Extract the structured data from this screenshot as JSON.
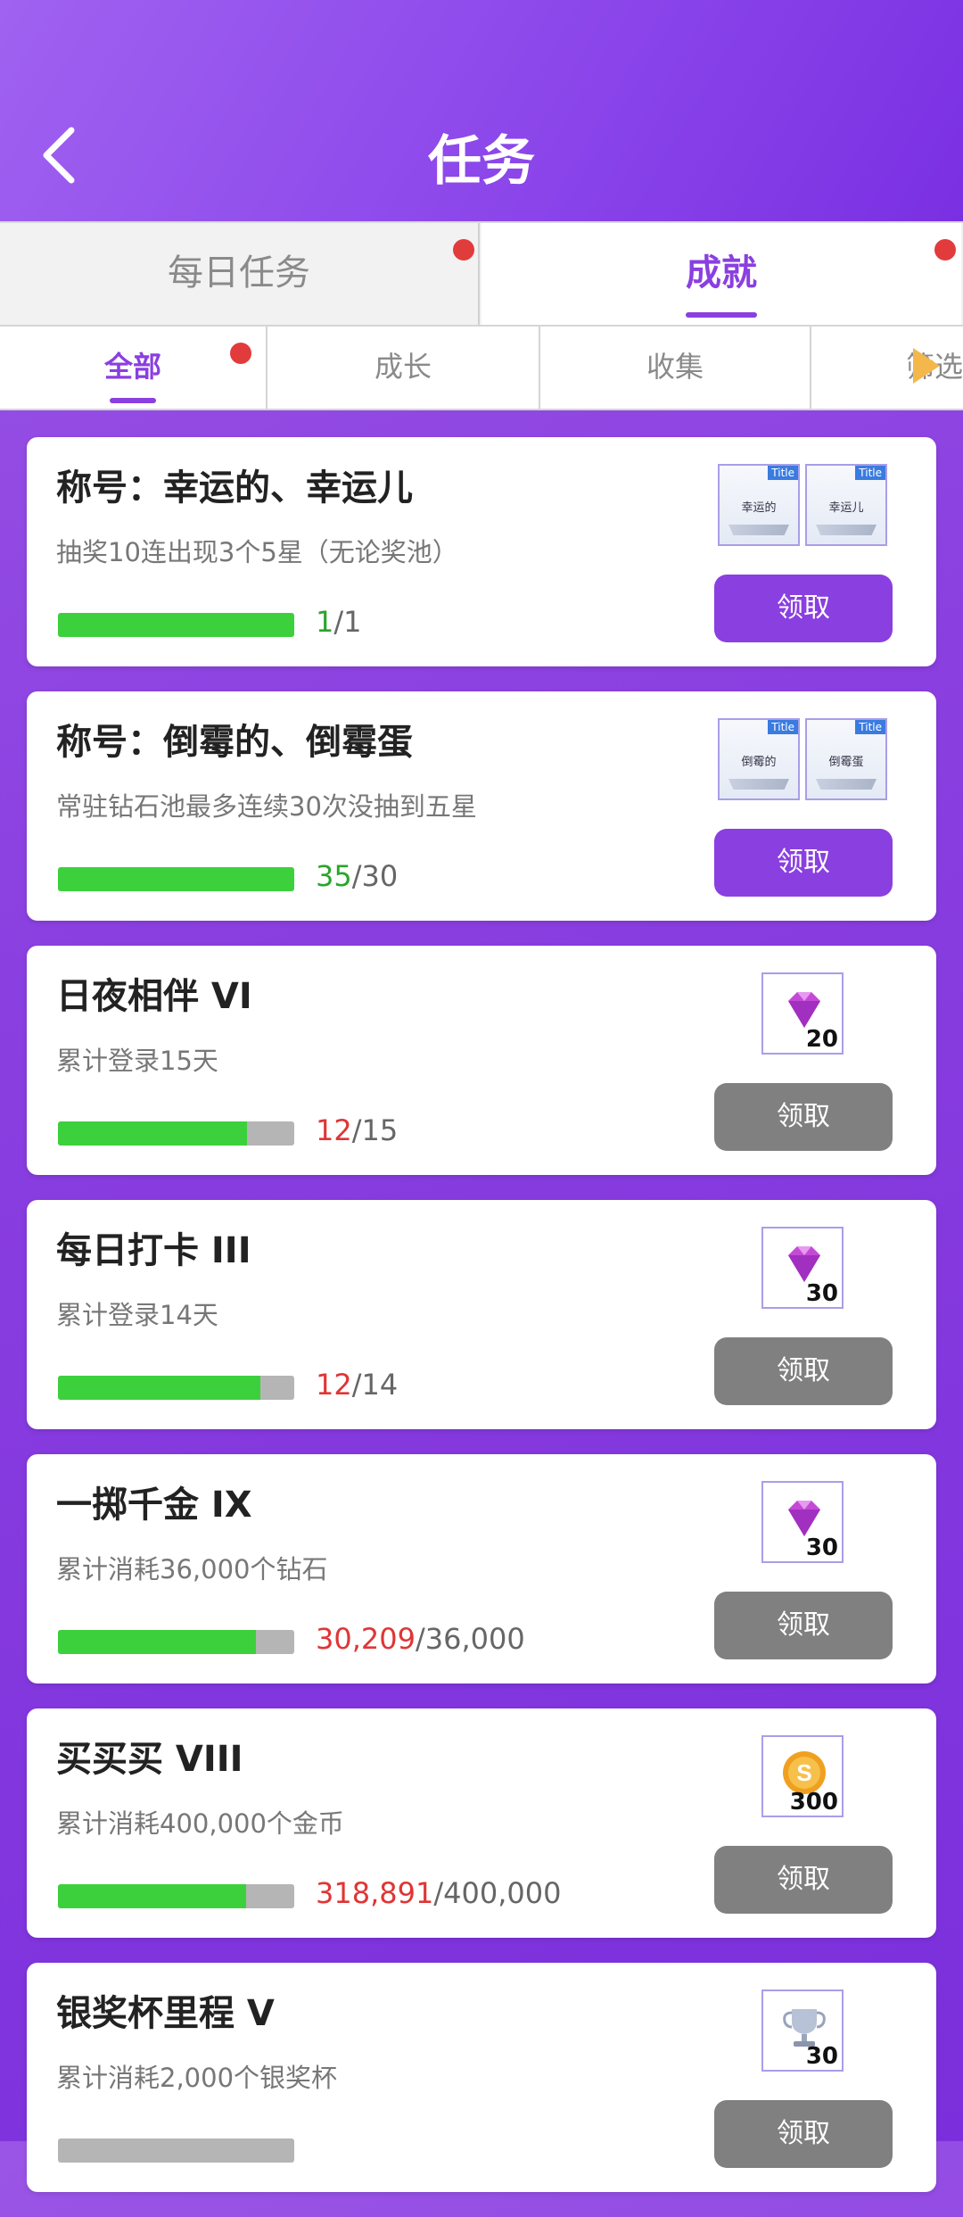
{
  "header": {
    "title": "任务",
    "back_icon": "chevron-left-icon"
  },
  "tabs": [
    {
      "label": "每日任务",
      "active": false,
      "has_dot": true
    },
    {
      "label": "成就",
      "active": true,
      "has_dot": true
    }
  ],
  "subtabs": [
    {
      "label": "全部",
      "active": true,
      "has_dot": true
    },
    {
      "label": "成长",
      "active": false
    },
    {
      "label": "收集",
      "active": false
    },
    {
      "label": "筛选",
      "active": false
    }
  ],
  "colors": {
    "accent": "#8a3fe0",
    "progress": "#3cd13c",
    "dot": "#e23b3b",
    "disabled": "#808080"
  },
  "achievements": [
    {
      "title": "称号：幸运的、幸运儿",
      "desc": "抽奖10连出现3个5星（无论奖池）",
      "current": "1",
      "total": "/1",
      "progress": 1.0,
      "current_color": "green",
      "button": "领取",
      "button_active": true,
      "reward_type": "title-cards",
      "title_cards": [
        {
          "tag": "Title",
          "name": "幸运的"
        },
        {
          "tag": "Title",
          "name": "幸运儿"
        }
      ]
    },
    {
      "title": "称号：倒霉的、倒霉蛋",
      "desc": "常驻钻石池最多连续30次没抽到五星",
      "current": "35",
      "total": "/30",
      "progress": 1.0,
      "current_color": "green",
      "button": "领取",
      "button_active": true,
      "reward_type": "title-cards",
      "title_cards": [
        {
          "tag": "Title",
          "name": "倒霉的"
        },
        {
          "tag": "Title",
          "name": "倒霉蛋"
        }
      ]
    },
    {
      "title": "日夜相伴  VI",
      "desc": "累计登录15天",
      "current": "12",
      "total": "/15",
      "progress": 0.8,
      "current_color": "red",
      "button": "领取",
      "button_active": false,
      "reward_type": "diamond",
      "reward_icon": "diamond-icon",
      "reward_qty": "20"
    },
    {
      "title": "每日打卡  III",
      "desc": "累计登录14天",
      "current": "12",
      "total": "/14",
      "progress": 0.857,
      "current_color": "red",
      "button": "领取",
      "button_active": false,
      "reward_type": "diamond",
      "reward_icon": "diamond-icon",
      "reward_qty": "30"
    },
    {
      "title": "一掷千金  IX",
      "desc": "累计消耗36,000个钻石",
      "current": "30,209",
      "total": "/36,000",
      "progress": 0.839,
      "current_color": "red",
      "button": "领取",
      "button_active": false,
      "reward_type": "diamond",
      "reward_icon": "diamond-icon",
      "reward_qty": "30"
    },
    {
      "title": "买买买  VIII",
      "desc": "累计消耗400,000个金币",
      "current": "318,891",
      "total": "/400,000",
      "progress": 0.797,
      "current_color": "red",
      "button": "领取",
      "button_active": false,
      "reward_type": "coin",
      "reward_icon": "gold-coin-icon",
      "reward_qty": "300"
    },
    {
      "title": "银奖杯里程  V",
      "desc": "累计消耗2,000个银奖杯",
      "current": "",
      "total": "",
      "progress": 0,
      "current_color": "red",
      "button": "领取",
      "button_active": false,
      "reward_type": "trophy",
      "reward_icon": "silver-trophy-icon",
      "reward_qty": "30"
    }
  ]
}
